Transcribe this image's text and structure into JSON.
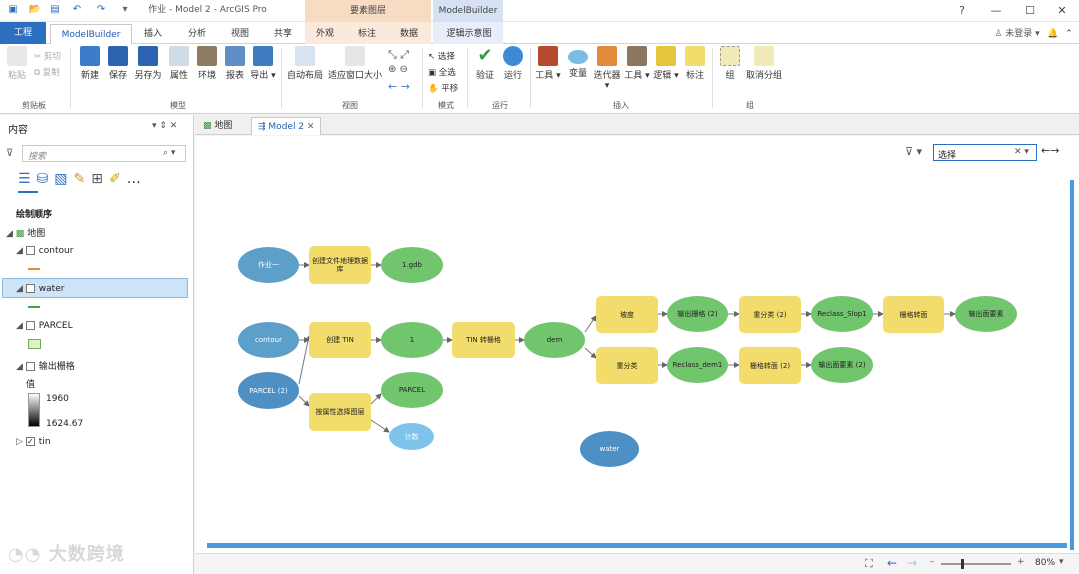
{
  "titlebar": {
    "title": "作业 - Model 2 - ArcGIS Pro",
    "ctx1": "要素图层",
    "ctx2": "ModelBuilder",
    "help": "?",
    "min": "—",
    "max": "☐",
    "close": "✕"
  },
  "tabs": {
    "project": "工程",
    "items": [
      "ModelBuilder",
      "插入",
      "分析",
      "视图",
      "共享",
      "外观",
      "标注",
      "数据",
      "逻辑示意图"
    ],
    "login": "未登录"
  },
  "ribbon": {
    "clipboard": {
      "paste": "粘贴",
      "cut": "剪切",
      "copy": "复制",
      "group": "剪贴板"
    },
    "model": {
      "new": "新建",
      "save": "保存",
      "saveas": "另存为",
      "props": "属性",
      "env": "环境",
      "report": "报表",
      "export": "导出",
      "group": "模型"
    },
    "view": {
      "autolayout": "自动布局",
      "fit": "适应窗口大小",
      "group": "视图"
    },
    "mode": {
      "select": "选择",
      "selectall": "全选",
      "pan": "平移",
      "group": "模式"
    },
    "run": {
      "validate": "验证",
      "run": "运行",
      "group": "运行"
    },
    "insert": {
      "tools": "工具",
      "variable": "变量",
      "iterators": "迭代器",
      "utilities": "工具",
      "logic": "逻辑",
      "label": "标注",
      "group": "插入"
    },
    "group": {
      "group": "组",
      "ungroup": "取消分组",
      "grpname": "组"
    }
  },
  "pane": {
    "title": "内容",
    "search_placeholder": "搜索",
    "draw_order": "绘制顺序",
    "map": "地图",
    "layers": [
      {
        "name": "contour"
      },
      {
        "name": "water"
      },
      {
        "name": "PARCEL"
      },
      {
        "name": "输出栅格"
      }
    ],
    "value_label": "值",
    "high": "1960",
    "low": "1624.67",
    "tin": "tin"
  },
  "doctabs": {
    "map": "地图",
    "model": "Model 2"
  },
  "canvas": {
    "filter_value": "选择"
  },
  "nodes": {
    "zuoye": "作业一",
    "create_gdb": "创建文件地理数据库",
    "gdb": "1.gdb",
    "contour": "contour",
    "create_tin": "创建 TIN",
    "one": "1",
    "tin2raster": "TIN 转栅格",
    "dem": "dem",
    "slope": "坡度",
    "out_raster2": "输出栅格 (2)",
    "reclass2": "重分类 (2)",
    "reclass_slop": "Reclass_Slop1",
    "r2p": "栅格转面",
    "out_poly": "输出面要素",
    "reclass": "重分类",
    "reclass_dem": "Reclass_dem1",
    "r2p2": "栅格转面 (2)",
    "out_poly2": "输出面要素 (2)",
    "parcel2": "PARCEL (2)",
    "select_attr": "按属性选择图层",
    "parcel": "PARCEL",
    "count": "计数",
    "water": "water"
  },
  "status": {
    "zoom": "80%"
  },
  "watermark": "大数跨境"
}
